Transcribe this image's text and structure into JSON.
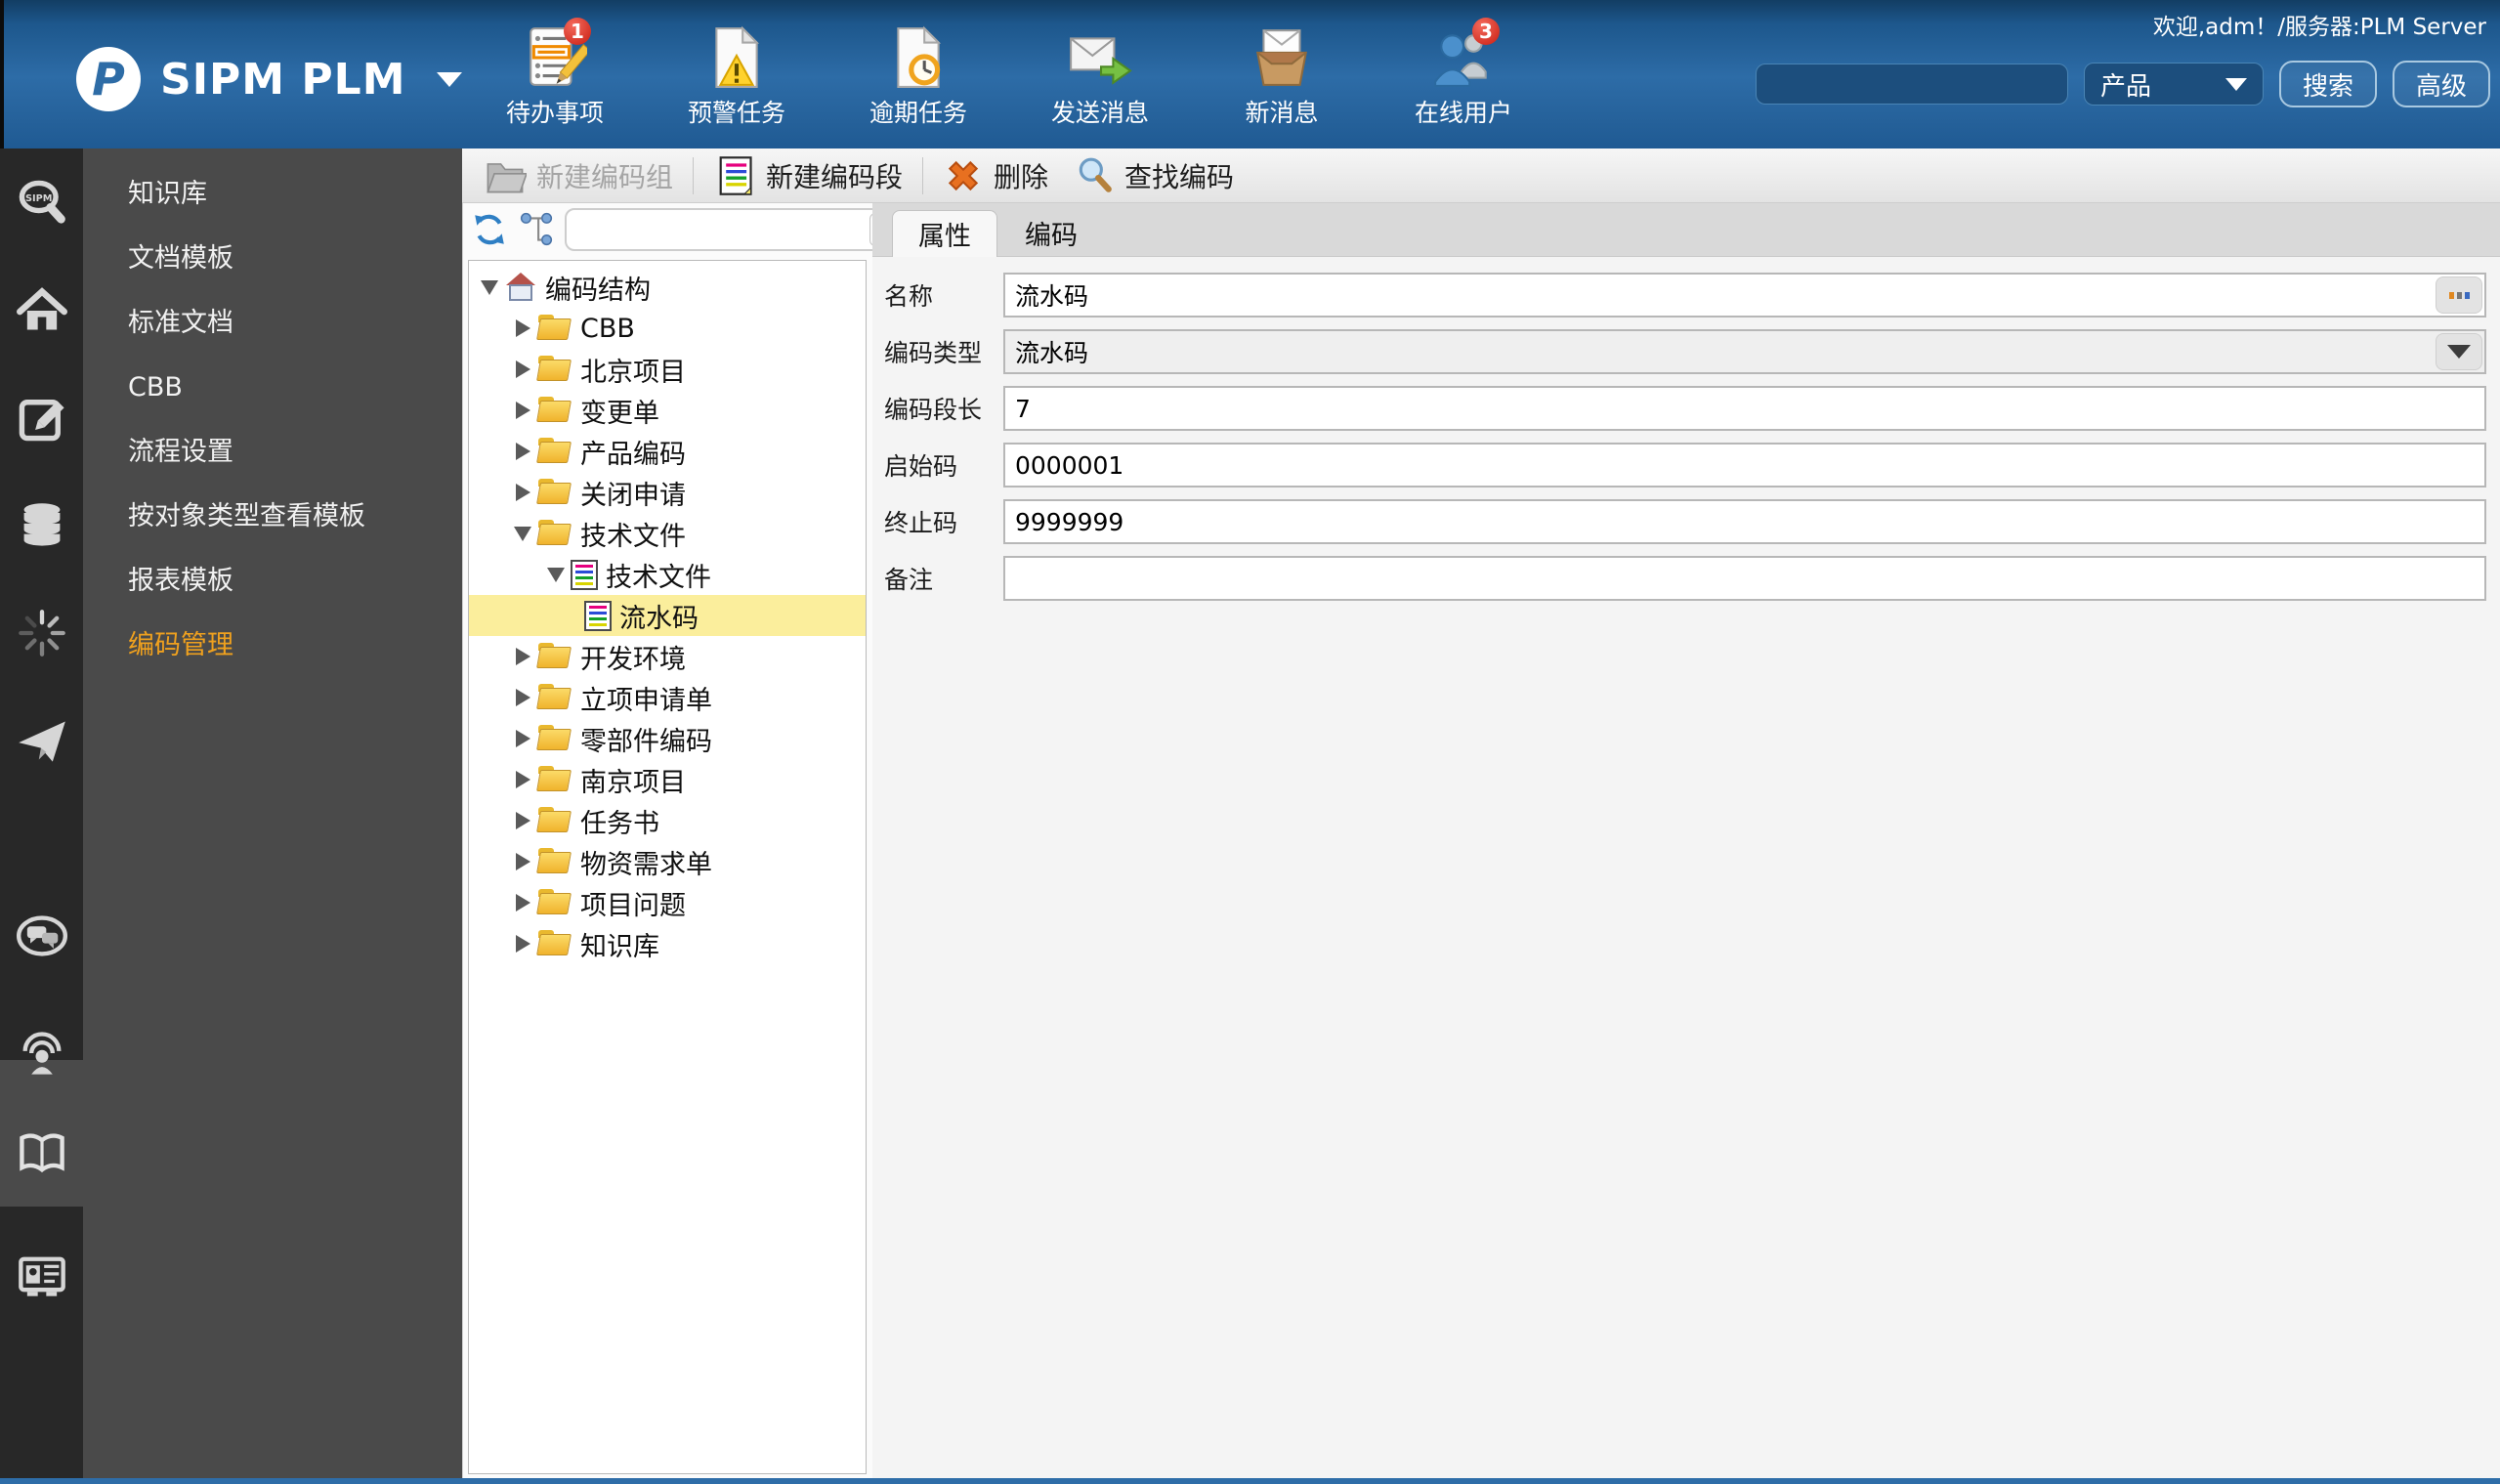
{
  "header": {
    "app_title": "SIPM PLM",
    "welcome": "欢迎,adm！/服务器:PLM Server",
    "tools": [
      {
        "label": "待办事项",
        "icon": "todo-list-icon",
        "badge": "1"
      },
      {
        "label": "预警任务",
        "icon": "warning-task-icon"
      },
      {
        "label": "逾期任务",
        "icon": "overdue-task-icon"
      },
      {
        "label": "发送消息",
        "icon": "send-message-icon"
      },
      {
        "label": "新消息",
        "icon": "new-message-icon"
      },
      {
        "label": "在线用户",
        "icon": "online-users-icon",
        "badge": "3"
      }
    ],
    "search": {
      "value": "",
      "category": "产品",
      "search_button": "搜索",
      "advanced_button": "高级"
    }
  },
  "sidebar": {
    "icons": [
      "sipm-search",
      "home",
      "edit",
      "database",
      "loading",
      "send-plane",
      "chat",
      "broadcast",
      "book",
      "id-card"
    ],
    "active_icon": "book"
  },
  "menu": {
    "items": [
      {
        "label": "知识库"
      },
      {
        "label": "文档模板"
      },
      {
        "label": "标准文档"
      },
      {
        "label": "CBB"
      },
      {
        "label": "流程设置"
      },
      {
        "label": "按对象类型查看模板"
      },
      {
        "label": "报表模板"
      },
      {
        "label": "编码管理",
        "active": true
      }
    ]
  },
  "codes_toolbar": {
    "buttons": [
      {
        "label": "新建编码组",
        "disabled": true
      },
      {
        "label": "新建编码段"
      },
      {
        "label": "删除"
      },
      {
        "label": "查找编码"
      }
    ]
  },
  "tree": {
    "filter_value": "",
    "items": [
      {
        "label": "编码结构",
        "level": 0,
        "state": "expanded",
        "icon": "home"
      },
      {
        "label": "CBB",
        "level": 1,
        "state": "collapsed",
        "icon": "folder"
      },
      {
        "label": "北京项目",
        "level": 1,
        "state": "collapsed",
        "icon": "folder"
      },
      {
        "label": "变更单",
        "level": 1,
        "state": "collapsed",
        "icon": "folder"
      },
      {
        "label": "产品编码",
        "level": 1,
        "state": "collapsed",
        "icon": "folder"
      },
      {
        "label": "关闭申请",
        "level": 1,
        "state": "collapsed",
        "icon": "folder"
      },
      {
        "label": "技术文件",
        "level": 1,
        "state": "expanded",
        "icon": "folder"
      },
      {
        "label": "技术文件",
        "level": 2,
        "state": "expanded",
        "icon": "doc"
      },
      {
        "label": "流水码",
        "level": 3,
        "state": "leaf",
        "icon": "doc",
        "selected": true
      },
      {
        "label": "开发环境",
        "level": 1,
        "state": "collapsed",
        "icon": "folder"
      },
      {
        "label": "立项申请单",
        "level": 1,
        "state": "collapsed",
        "icon": "folder"
      },
      {
        "label": "零部件编码",
        "level": 1,
        "state": "collapsed",
        "icon": "folder"
      },
      {
        "label": "南京项目",
        "level": 1,
        "state": "collapsed",
        "icon": "folder"
      },
      {
        "label": "任务书",
        "level": 1,
        "state": "collapsed",
        "icon": "folder"
      },
      {
        "label": "物资需求单",
        "level": 1,
        "state": "collapsed",
        "icon": "folder"
      },
      {
        "label": "项目问题",
        "level": 1,
        "state": "collapsed",
        "icon": "folder"
      },
      {
        "label": "知识库",
        "level": 1,
        "state": "collapsed",
        "icon": "folder"
      }
    ]
  },
  "tabs": [
    {
      "label": "属性",
      "active": true
    },
    {
      "label": "编码",
      "active": false
    }
  ],
  "form": {
    "fields": [
      {
        "label": "名称",
        "value": "流水码",
        "control": "text-with-picker"
      },
      {
        "label": "编码类型",
        "value": "流水码",
        "control": "select"
      },
      {
        "label": "编码段长",
        "value": "7",
        "control": "text"
      },
      {
        "label": "启始码",
        "value": "0000001",
        "control": "text"
      },
      {
        "label": "终止码",
        "value": "9999999",
        "control": "text"
      },
      {
        "label": "备注",
        "value": "",
        "control": "text"
      }
    ]
  },
  "colors": {
    "header_blue": "#2d6ca7",
    "panel_dark": "#282828",
    "panel_gray": "#4a4a4a",
    "accent_orange": "#f0a11e",
    "selection_yellow": "#fbee9c",
    "badge_red": "#c81e12"
  }
}
